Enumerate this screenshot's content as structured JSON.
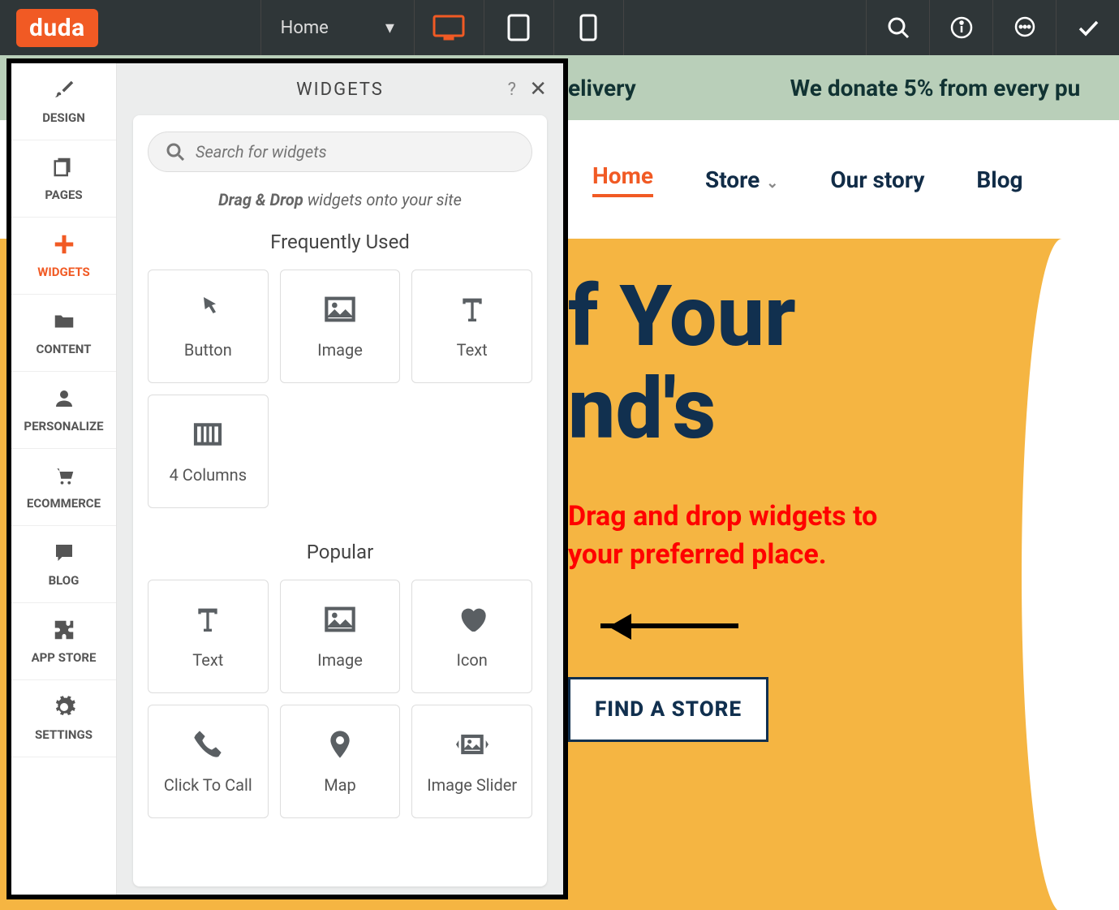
{
  "topbar": {
    "logo": "duda",
    "page_selector": "Home"
  },
  "sidebar": {
    "items": [
      {
        "label": "DESIGN"
      },
      {
        "label": "PAGES"
      },
      {
        "label": "WIDGETS"
      },
      {
        "label": "CONTENT"
      },
      {
        "label": "PERSONALIZE"
      },
      {
        "label": "ECOMMERCE"
      },
      {
        "label": "BLOG"
      },
      {
        "label": "APP STORE"
      },
      {
        "label": "SETTINGS"
      }
    ]
  },
  "panel": {
    "title": "WIDGETS",
    "help": "?",
    "close": "✕",
    "search_placeholder": "Search for widgets",
    "hint_bold": "Drag & Drop",
    "hint_rest": " widgets onto your site",
    "sections": {
      "frequent": {
        "title": "Frequently Used",
        "items": [
          {
            "label": "Button"
          },
          {
            "label": "Image"
          },
          {
            "label": "Text"
          },
          {
            "label": "4 Columns"
          }
        ]
      },
      "popular": {
        "title": "Popular",
        "items": [
          {
            "label": "Text"
          },
          {
            "label": "Image"
          },
          {
            "label": "Icon"
          },
          {
            "label": "Click To Call"
          },
          {
            "label": "Map"
          },
          {
            "label": "Image Slider"
          }
        ]
      }
    }
  },
  "site": {
    "promo1": "elivery",
    "promo2": "We donate 5% from every pu",
    "nav": {
      "home": "Home",
      "store": "Store",
      "story": "Our story",
      "blog": "Blog"
    },
    "hero_line1": "f Your",
    "hero_line2": "nd's",
    "annotation_l1": "Drag and drop widgets to",
    "annotation_l2": "your preferred place.",
    "cta": "FIND A STORE"
  }
}
